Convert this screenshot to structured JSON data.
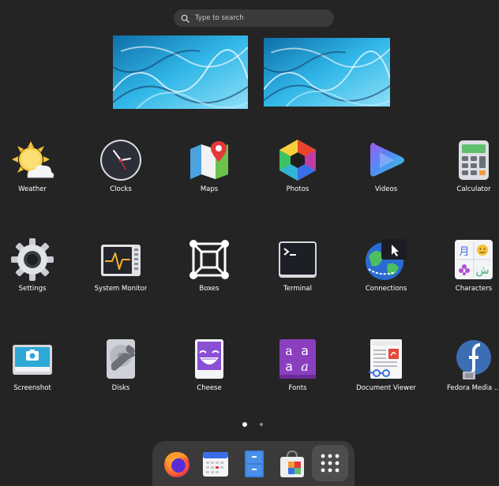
{
  "search": {
    "placeholder": "Type to search"
  },
  "apps": [
    {
      "label": "Weather",
      "icon": "weather-icon"
    },
    {
      "label": "Clocks",
      "icon": "clock-icon"
    },
    {
      "label": "Maps",
      "icon": "maps-icon"
    },
    {
      "label": "Photos",
      "icon": "photos-icon"
    },
    {
      "label": "Videos",
      "icon": "videos-icon"
    },
    {
      "label": "Calculator",
      "icon": "calculator-icon"
    },
    {
      "label": "Settings",
      "icon": "gear-icon"
    },
    {
      "label": "System Monitor",
      "icon": "system-monitor-icon"
    },
    {
      "label": "Boxes",
      "icon": "boxes-icon"
    },
    {
      "label": "Terminal",
      "icon": "terminal-icon"
    },
    {
      "label": "Connections",
      "icon": "connections-icon"
    },
    {
      "label": "Characters",
      "icon": "characters-icon"
    },
    {
      "label": "Screenshot",
      "icon": "screenshot-icon"
    },
    {
      "label": "Disks",
      "icon": "disks-icon"
    },
    {
      "label": "Cheese",
      "icon": "cheese-icon"
    },
    {
      "label": "Fonts",
      "icon": "fonts-icon"
    },
    {
      "label": "Document Viewer",
      "icon": "document-viewer-icon"
    },
    {
      "label": "Fedora Media ...",
      "icon": "fedora-icon"
    }
  ],
  "pager": {
    "pages": 2,
    "current": 1
  },
  "dock": [
    {
      "icon": "firefox-icon"
    },
    {
      "icon": "calendar-icon"
    },
    {
      "icon": "file-cabinet-icon"
    },
    {
      "icon": "software-store-icon"
    },
    {
      "icon": "app-grid-icon"
    }
  ]
}
